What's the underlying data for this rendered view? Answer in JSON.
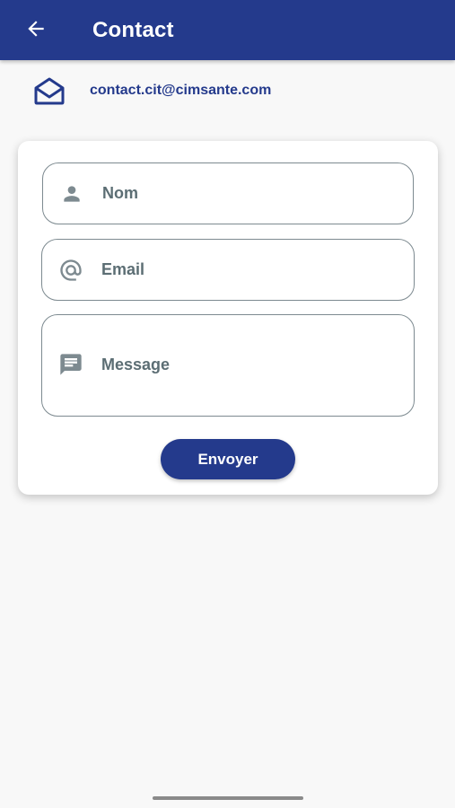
{
  "app_bar": {
    "title": "Contact",
    "back_icon": "arrow-left-icon",
    "background_color": "#243a8c"
  },
  "contact": {
    "icon": "envelope-open-icon",
    "email": "contact.cit@cimsante.com"
  },
  "form": {
    "fields": [
      {
        "icon": "person-icon",
        "placeholder": "Nom"
      },
      {
        "icon": "at-sign-icon",
        "placeholder": "Email"
      },
      {
        "icon": "message-icon",
        "placeholder": "Message"
      }
    ],
    "submit_label": "Envoyer",
    "accent_color": "#243a8c"
  }
}
